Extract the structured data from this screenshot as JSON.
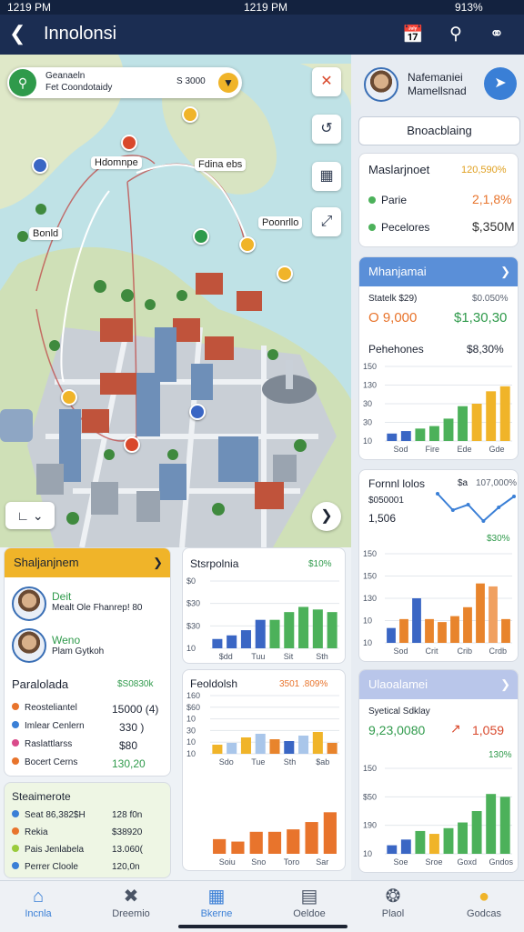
{
  "status_bar": {
    "time": "1219 PM",
    "battery": "913%"
  },
  "app_bar": {
    "title": "Innolonsi",
    "icons": [
      "back-icon",
      "calendar-icon",
      "search-icon",
      "share-icon"
    ]
  },
  "map": {
    "search": {
      "line1": "Geanaeln",
      "line2": "Fet Coondotaidy",
      "value": "S 3000"
    },
    "labels": {
      "a": "Hdomnpe",
      "b": "Fdina ebs",
      "c": "Bonld",
      "d": "Poonrllo"
    },
    "controls": [
      "layers-icon",
      "route-icon",
      "calendar-icon",
      "expand-icon"
    ]
  },
  "profile": {
    "name": "Nafemaniei",
    "subtitle": "Mamellsnad"
  },
  "broadcast_button": "Bnoacblaing",
  "summary": {
    "title": "Maslarjnoet",
    "value": "120,590%",
    "rows": [
      {
        "label": "Parie",
        "value": "2,1,8%"
      },
      {
        "label": "Pecelores",
        "value": "$,350M"
      }
    ]
  },
  "panel_a": {
    "header": "Mhanjamai",
    "row1_label": "Statelk $29)",
    "row1_right": "$0.050%",
    "row2_left": "O 9,000",
    "row2_right": "$1,30,30",
    "subtitle": "Pehehones",
    "subtitle_value": "$8,30%",
    "yticks": [
      "150",
      "130",
      "30",
      "30",
      "10"
    ],
    "xticks": [
      "Sod",
      "Fire",
      "Ede",
      "Gde"
    ]
  },
  "panel_b": {
    "title": "Fornnl lolos",
    "title_note": "$a",
    "title_value": "107,000%",
    "row1": "$050001",
    "row2": "1,506",
    "pct": "$30%",
    "yticks": [
      "150",
      "150",
      "130",
      "10",
      "10"
    ],
    "xticks": [
      "Sod",
      "Crit",
      "Crib",
      "Crdb"
    ]
  },
  "panel_c": {
    "header": "Ulaoalamei",
    "row1_label": "Syetical Sdklay",
    "row1_value": "9,23,0080",
    "row1_right": "1,059",
    "pct": "130%",
    "yticks": [
      "150",
      "$50",
      "190",
      "10"
    ],
    "xticks": [
      "Soe",
      "Sroe",
      "Goxd",
      "Gndos"
    ]
  },
  "team_card": {
    "header": "Shaljanjnem",
    "people": [
      {
        "name": "Deit",
        "detail": "Mealt Ole Fhanrep! 80"
      },
      {
        "name": "Weno",
        "detail": "Plam Gytkoh"
      }
    ],
    "list_title": "Paralolada",
    "list_value": "$S0830k",
    "items": [
      {
        "label": "Reosteliantel",
        "value": "15000 (4)",
        "color": "#e8742c"
      },
      {
        "label": "Imlear Cenlern",
        "value": "330 )",
        "color": "#3a7fd6"
      },
      {
        "label": "Raslattlarss",
        "value": "$80",
        "color": "#d94b8a"
      },
      {
        "label": "Bocert Cerns",
        "value": "130,20",
        "color": "#e8742c"
      }
    ]
  },
  "stats_card": {
    "header": "Steaimerote",
    "items": [
      {
        "label": "Seat 86,382$H",
        "value": "128 f0n",
        "color": "#3a7fd6"
      },
      {
        "label": "Rekia",
        "value": "$38920",
        "color": "#e8742c"
      },
      {
        "label": "Pais Jenlabela",
        "value": "13.060(",
        "color": "#9acb3c"
      },
      {
        "label": "Perrer Cloole",
        "value": "120,0n",
        "color": "#3a7fd6"
      }
    ]
  },
  "chart_mid_top": {
    "title": "Stsrpolnia",
    "value": "$10%",
    "yticks": [
      "$0",
      "$30",
      "$30",
      "10"
    ],
    "xticks": [
      "$dd",
      "Tuu",
      "Sit",
      "Sth"
    ]
  },
  "chart_mid_bottom": {
    "title": "Feoldolsh",
    "value": "3501 .809%",
    "yticks": [
      "160",
      "$60",
      "10",
      "30",
      "10",
      "10"
    ],
    "xticks": [
      "Sdo",
      "Tue",
      "Sth",
      "$ab"
    ],
    "xticks2": [
      "Soiu",
      "Sno",
      "Toro",
      "Sar"
    ]
  },
  "bottom_nav": [
    {
      "label": "Incnla",
      "icon": "home-icon"
    },
    {
      "label": "Dreemio",
      "icon": "tools-icon"
    },
    {
      "label": "Bkerne",
      "icon": "calendar-icon"
    },
    {
      "label": "Oeldoe",
      "icon": "briefcase-icon"
    },
    {
      "label": "Plaol",
      "icon": "compass-icon"
    },
    {
      "label": "Godcas",
      "icon": "bulb-icon"
    }
  ],
  "chart_data": [
    {
      "type": "bar",
      "title": "Pehehones",
      "ylim": [
        0,
        150
      ],
      "categories": [
        "Sod",
        "Fire",
        "Ede",
        "Gde"
      ],
      "values": [
        15,
        20,
        25,
        30,
        45,
        70,
        75,
        100,
        110
      ],
      "colors": [
        "#3a66c4",
        "#3a66c4",
        "#4cb15a",
        "#4cb15a",
        "#4cb15a",
        "#4cb15a",
        "#f0b429",
        "#f0b429",
        "#f0b429"
      ]
    },
    {
      "type": "line",
      "title": "Fornnl lolos",
      "values": [
        60,
        30,
        40,
        10,
        35,
        55
      ]
    },
    {
      "type": "bar",
      "title": "Fornnl lolos",
      "ylim": [
        0,
        150
      ],
      "categories": [
        "Sod",
        "Crit",
        "Crib",
        "Crdb"
      ],
      "values": [
        25,
        40,
        75,
        40,
        35,
        45,
        60,
        100,
        95,
        40
      ],
      "colors": [
        "#3a66c4",
        "#e8842c",
        "#3a66c4",
        "#e8842c",
        "#e8842c",
        "#e8842c",
        "#e8842c",
        "#e8842c",
        "#f0a060",
        "#e8842c"
      ]
    },
    {
      "type": "bar",
      "title": "Ulaoalamei",
      "ylim": [
        0,
        150
      ],
      "categories": [
        "Soe",
        "Sroe",
        "Goxd",
        "Gndos"
      ],
      "values": [
        15,
        25,
        40,
        35,
        45,
        55,
        75,
        105,
        100
      ],
      "colors": [
        "#3a66c4",
        "#3a66c4",
        "#4cb15a",
        "#f0b429",
        "#4cb15a",
        "#4cb15a",
        "#4cb15a",
        "#4cb15a",
        "#4cb15a"
      ]
    },
    {
      "type": "bar",
      "title": "Stsrpolnia",
      "ylim": [
        0,
        130
      ],
      "categories": [
        "$dd",
        "Tuu",
        "Sit",
        "Sth"
      ],
      "values": [
        18,
        25,
        35,
        55,
        55,
        70,
        80,
        75,
        70
      ],
      "colors": [
        "#3a66c4",
        "#3a66c4",
        "#3a66c4",
        "#3a66c4",
        "#4cb15a",
        "#4cb15a",
        "#4cb15a",
        "#4cb15a",
        "#4cb15a"
      ]
    },
    {
      "type": "bar",
      "title": "Feoldolsh",
      "ylim": [
        0,
        160
      ],
      "categories": [
        "Sdo",
        "Tue",
        "Sth",
        "$ab"
      ],
      "values": [
        25,
        30,
        45,
        55,
        40,
        35,
        50,
        60,
        30
      ],
      "colors": [
        "#f0b429",
        "#a9c6ea",
        "#f0b429",
        "#a9c6ea",
        "#e8842c",
        "#3a66c4",
        "#a9c6ea",
        "#f0b429",
        "#e8842c"
      ]
    },
    {
      "type": "bar",
      "title": "Feoldolsh",
      "ylim": [
        0,
        160
      ],
      "categories": [
        "Soiu",
        "Sno",
        "Toro",
        "Sar"
      ],
      "values": [
        30,
        25,
        45,
        45,
        50,
        65,
        85
      ],
      "colors": [
        "#e8742c",
        "#e8742c",
        "#e8742c",
        "#e8742c",
        "#e8742c",
        "#e8742c",
        "#e8742c"
      ]
    }
  ]
}
